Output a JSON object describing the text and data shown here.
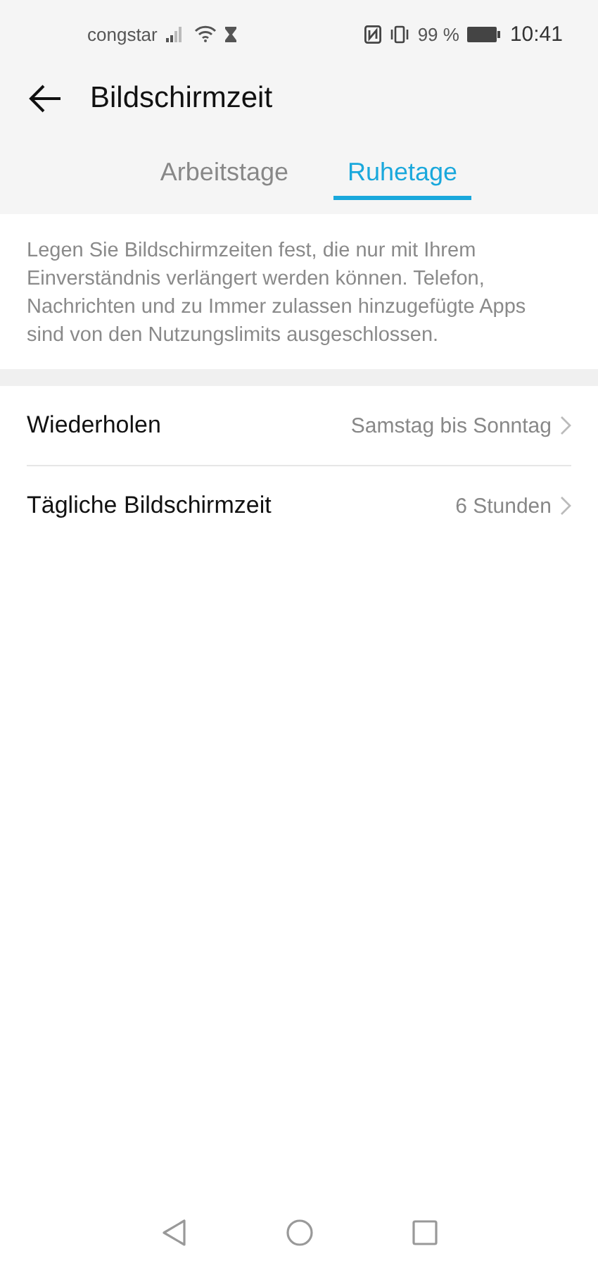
{
  "status_bar": {
    "carrier": "congstar",
    "battery": "99 %",
    "time": "10:41"
  },
  "header": {
    "title": "Bildschirmzeit"
  },
  "tabs": [
    {
      "label": "Arbeitstage",
      "selected": false
    },
    {
      "label": "Ruhetage",
      "selected": true
    }
  ],
  "description": "Legen Sie Bildschirmzeiten fest, die nur mit Ihrem Einverständnis verlängert werden können. Telefon, Nachrichten und zu Immer zulassen hinzugefügte Apps sind von den Nutzungslimits ausgeschlossen.",
  "settings": [
    {
      "label": "Wiederholen",
      "value": "Samstag bis Sonntag"
    },
    {
      "label": "Tägliche Bildschirmzeit",
      "value": "6 Stunden"
    }
  ]
}
